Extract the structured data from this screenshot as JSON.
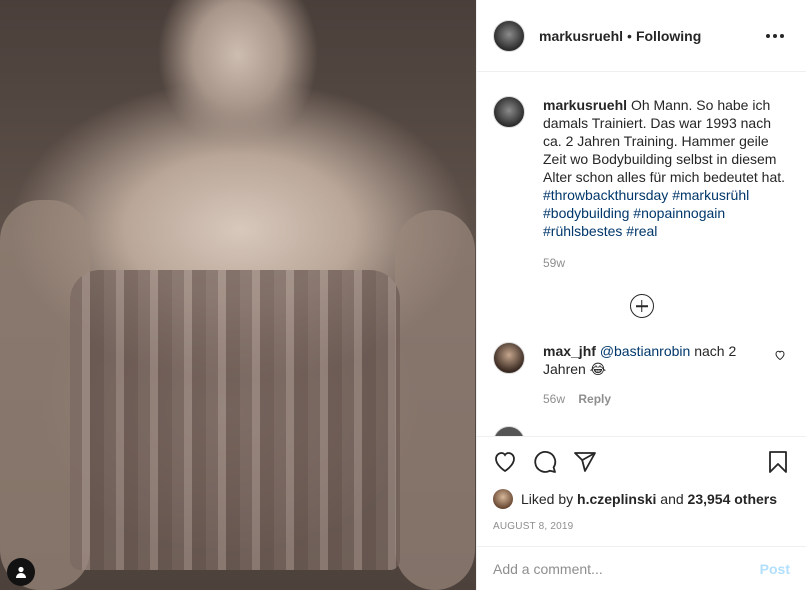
{
  "header": {
    "username": "markusruehl",
    "separator": "•",
    "follow_status": "Following"
  },
  "caption": {
    "username": "markusruehl",
    "text": "Oh Mann. So habe ich damals Trainiert. Das war 1993 nach ca. 2 Jahren Training. Hammer geile Zeit wo Bodybuilding selbst in diesem Alter schon alles für mich bedeutet hat.",
    "hashtags": [
      "#throwbackthursday",
      "#markusrühl",
      "#bodybuilding",
      "#nopainnogain",
      "#rühlsbestes",
      "#real"
    ],
    "time": "59w"
  },
  "comments": [
    {
      "username": "max_jhf",
      "mention": "@bastianrobin",
      "text": "nach 2 Jahren",
      "emoji": "😂",
      "time": "56w",
      "reply_label": "Reply"
    }
  ],
  "peek_comment": {
    "username": "",
    "text": ""
  },
  "likes": {
    "prefix": "Liked by",
    "user": "h.czeplinski",
    "joiner": "and",
    "others": "23,954 others"
  },
  "date": "AUGUST 8, 2019",
  "add_comment": {
    "placeholder": "Add a comment...",
    "post_label": "Post"
  },
  "colors": {
    "hashtag": "#00376b",
    "muted": "#8e8e8e",
    "post_disabled": "#b2dffc",
    "text": "#262626"
  },
  "icons": [
    "heart-icon",
    "comment-icon",
    "share-icon",
    "bookmark-icon",
    "more-icon",
    "plus-circle-icon",
    "user-tag-icon"
  ]
}
